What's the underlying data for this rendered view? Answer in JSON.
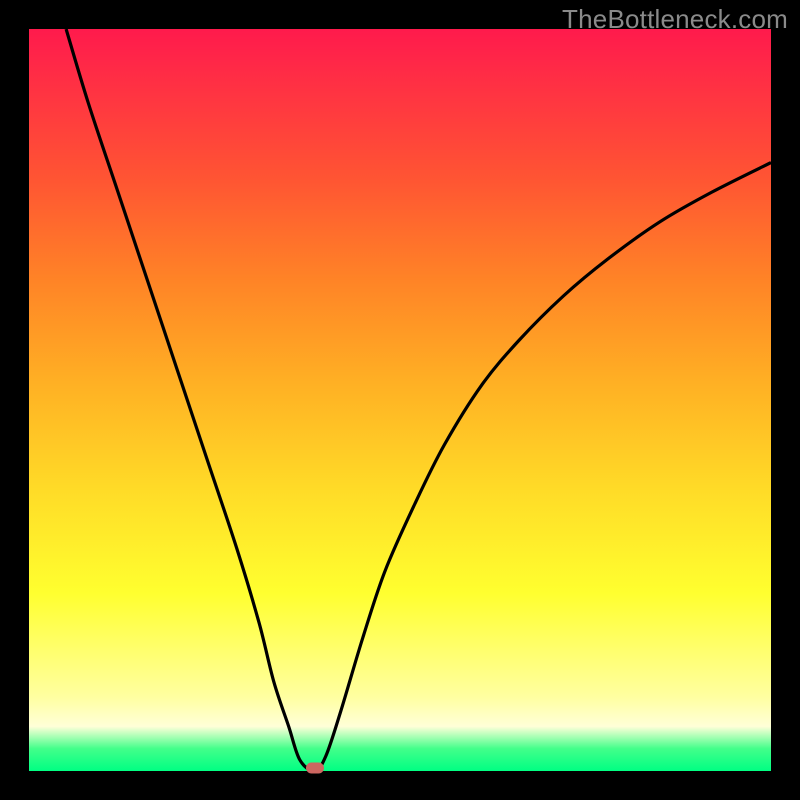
{
  "watermark": "TheBottleneck.com",
  "colors": {
    "page_bg": "#000000",
    "curve_stroke": "#000000",
    "marker_fill": "#cc6660"
  },
  "chart_data": {
    "type": "line",
    "title": "",
    "xlabel": "",
    "ylabel": "",
    "xlim": [
      0,
      100
    ],
    "ylim": [
      0,
      100
    ],
    "marker": {
      "x": 38.5,
      "y": 0
    },
    "series": [
      {
        "name": "left-branch",
        "x": [
          5,
          8,
          12,
          16,
          20,
          24,
          28,
          31,
          33,
          35,
          36.5,
          38.5
        ],
        "y": [
          100,
          90,
          78,
          66,
          54,
          42,
          30,
          20,
          12,
          6,
          1.5,
          0
        ]
      },
      {
        "name": "right-branch",
        "x": [
          38.5,
          40,
          42,
          45,
          48,
          52,
          56,
          61,
          66,
          72,
          78,
          85,
          92,
          100
        ],
        "y": [
          0,
          2,
          8,
          18,
          27,
          36,
          44,
          52,
          58,
          64,
          69,
          74,
          78,
          82
        ]
      }
    ]
  }
}
